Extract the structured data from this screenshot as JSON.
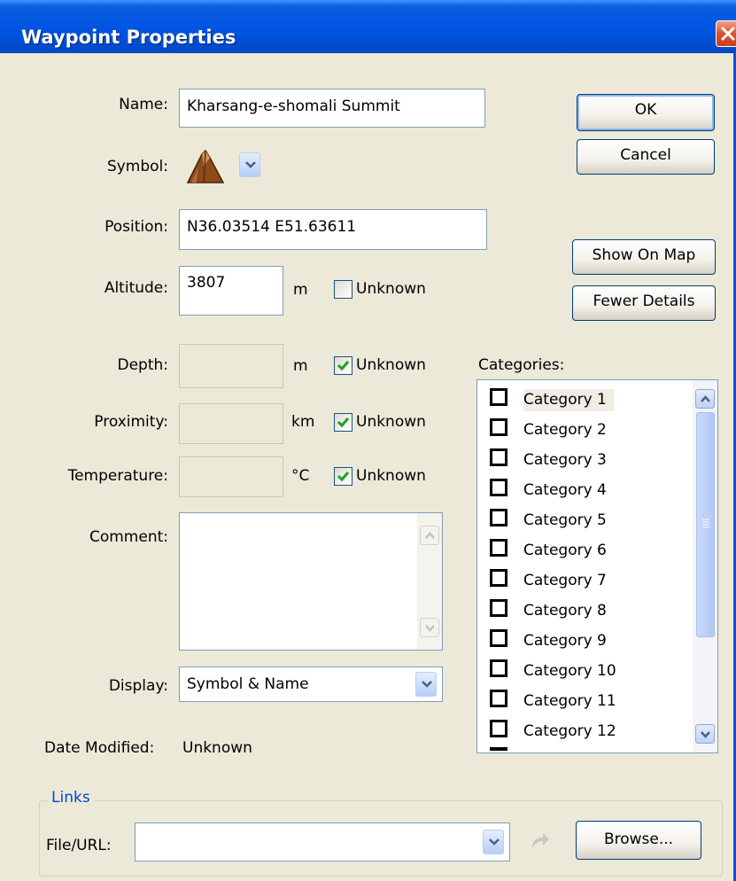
{
  "window": {
    "title": "Waypoint Properties"
  },
  "labels": {
    "name": "Name:",
    "symbol": "Symbol:",
    "position": "Position:",
    "altitude": "Altitude:",
    "depth": "Depth:",
    "proximity": "Proximity:",
    "temperature": "Temperature:",
    "comment": "Comment:",
    "display": "Display:",
    "date_modified": "Date Modified:",
    "categories": "Categories:"
  },
  "fields": {
    "name": "Kharsang-e-shomali Summit",
    "position": "N36.03514 E51.63611",
    "altitude": "3807",
    "depth": "",
    "proximity": "",
    "temperature": "",
    "comment": "",
    "display": "Symbol & Name",
    "date_modified": "Unknown"
  },
  "units": {
    "altitude": "m",
    "depth": "m",
    "proximity": "km",
    "temperature": "°C"
  },
  "unknown_checkboxes": {
    "label": "Unknown",
    "altitude": false,
    "depth": true,
    "proximity": true,
    "temperature": true
  },
  "buttons": {
    "ok": "OK",
    "cancel": "Cancel",
    "show_on_map": "Show On Map",
    "fewer_details": "Fewer Details",
    "browse": "Browse..."
  },
  "categories": {
    "items": [
      "Category 1",
      "Category 2",
      "Category 3",
      "Category 4",
      "Category 5",
      "Category 6",
      "Category 7",
      "Category 8",
      "Category 9",
      "Category 10",
      "Category 11",
      "Category 12"
    ],
    "selected_index": 0
  },
  "links": {
    "group_title": "Links",
    "file_url_label": "File/URL:",
    "file_url_value": ""
  },
  "icons": {
    "symbol": "mountain-summit-icon",
    "close": "close-icon",
    "dropdown": "chevron-down-icon",
    "go": "go-arrow-icon",
    "check": "checkmark-icon"
  },
  "colors": {
    "title_bar": "#0054e3",
    "dialog_bg": "#ece9d8",
    "group_title": "#0046d5",
    "close_button": "#d9542e"
  }
}
